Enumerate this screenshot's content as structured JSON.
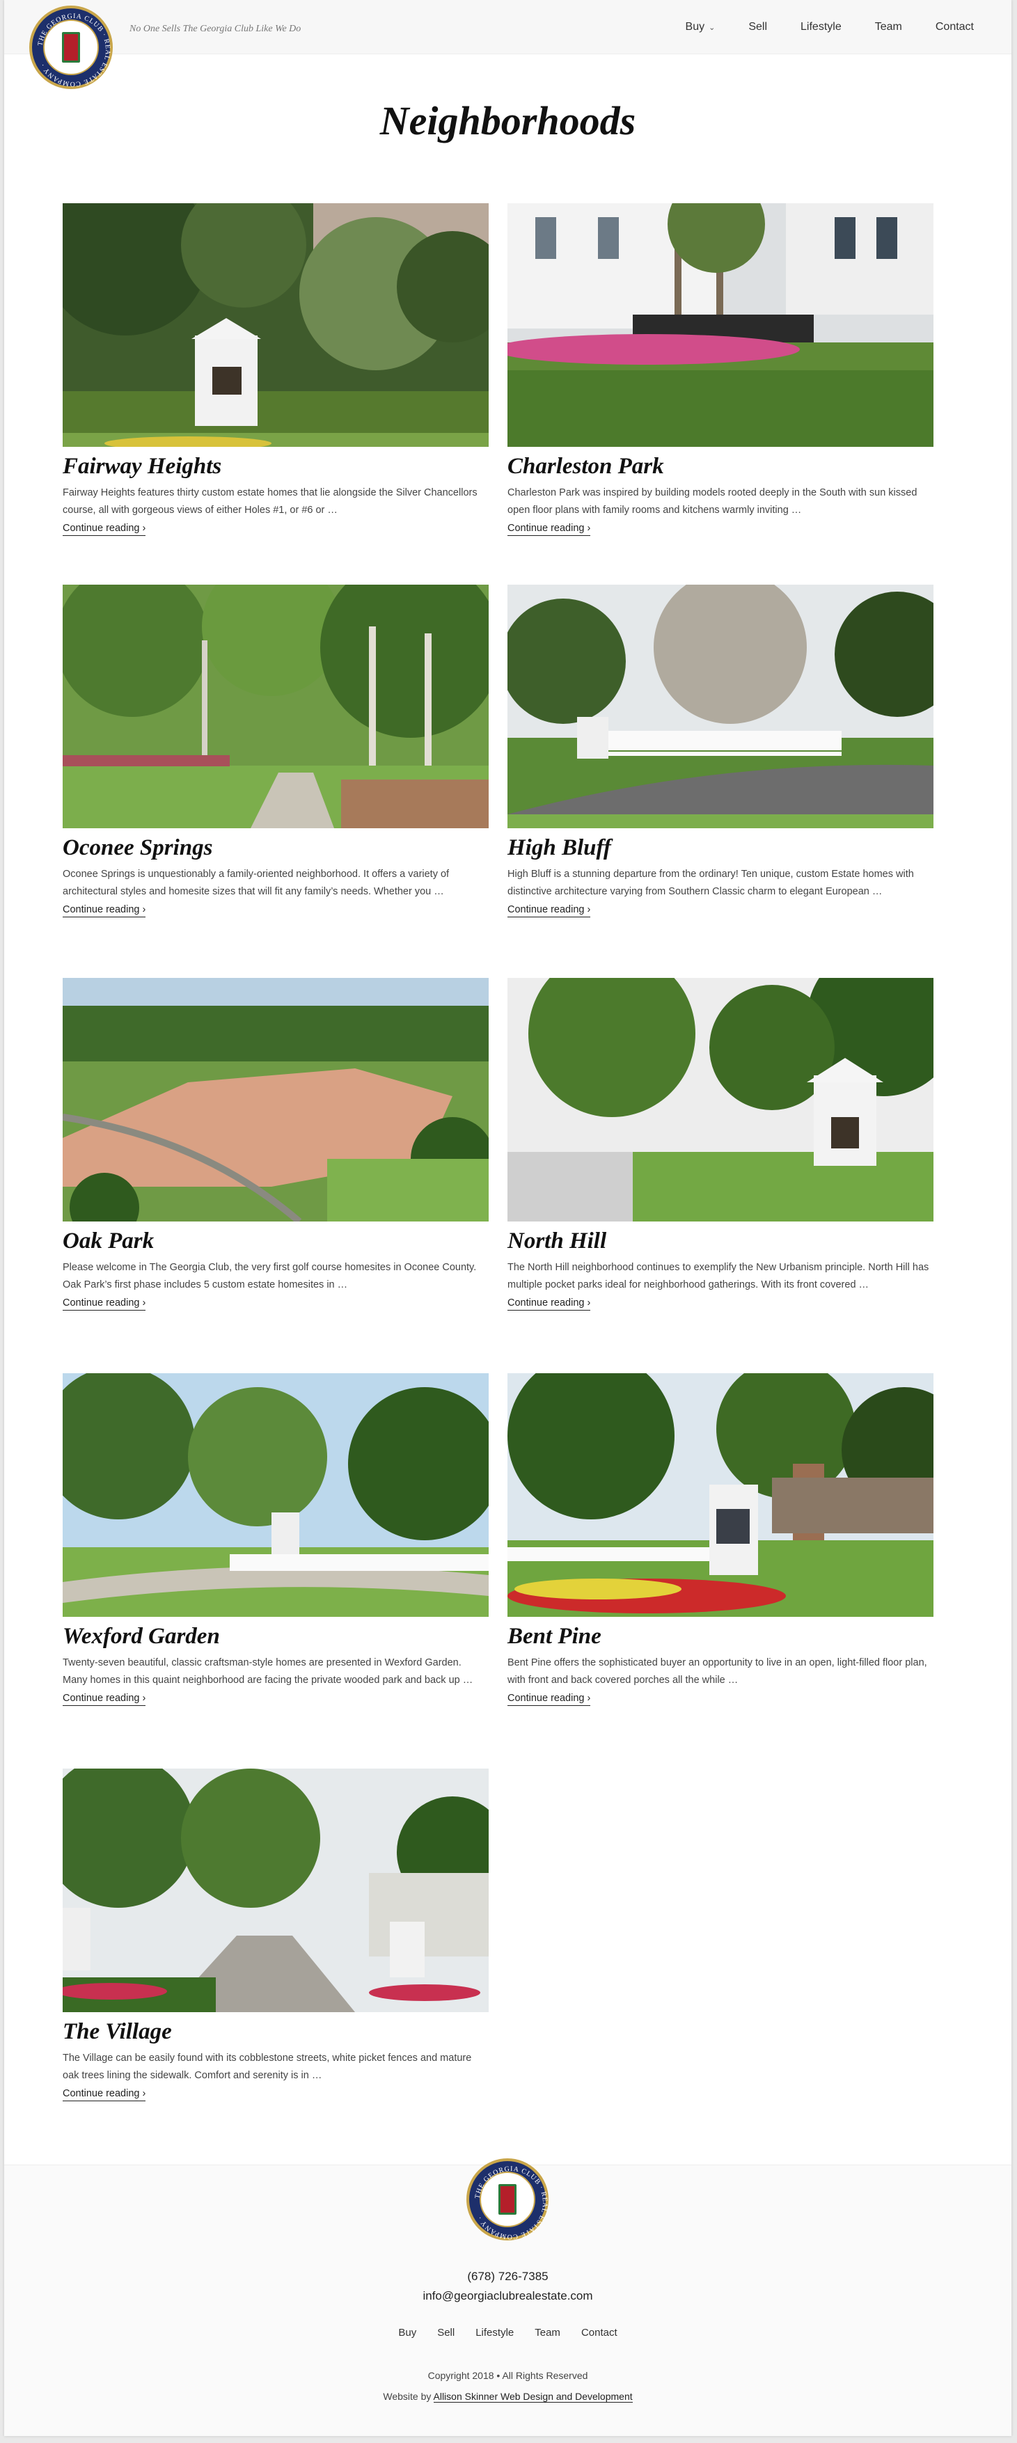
{
  "header": {
    "tagline": "No One Sells The Georgia Club Like We Do",
    "logo_text": "THE GEORGIA CLUB REAL ESTATE COMPANY",
    "nav": [
      {
        "label": "Buy",
        "has_dropdown": true
      },
      {
        "label": "Sell"
      },
      {
        "label": "Lifestyle"
      },
      {
        "label": "Team"
      },
      {
        "label": "Contact"
      }
    ]
  },
  "page_title": "Neighborhoods",
  "neighborhoods": [
    {
      "title": "Fairway Heights",
      "excerpt": "Fairway Heights features thirty custom estate homes that lie alongside the Silver Chancellors course, all with gorgeous views of either  Holes #1, or #6 or  …",
      "link": "Continue reading"
    },
    {
      "title": "Charleston Park",
      "excerpt": "Charleston Park was inspired by building models rooted deeply in the South with sun kissed open floor plans with family rooms and kitchens warmly inviting …",
      "link": "Continue reading"
    },
    {
      "title": "Oconee Springs",
      "excerpt": "Oconee Springs is unquestionably a family-oriented neighborhood.  It offers a variety of architectural styles and homesite sizes that will fit any family’s needs.  Whether you …",
      "link": "Continue reading"
    },
    {
      "title": "High Bluff",
      "excerpt": "High Bluff is a stunning departure from the ordinary!  Ten unique, custom Estate homes with distinctive architecture varying from Southern Classic charm to elegant European …",
      "link": "Continue reading"
    },
    {
      "title": "Oak Park",
      "excerpt": "Please welcome in The Georgia Club, the very first golf course homesites in Oconee County.  Oak Park’s first phase includes 5 custom estate homesites in …",
      "link": "Continue reading"
    },
    {
      "title": "North Hill",
      "excerpt": "The North Hill neighborhood continues to exemplify the  New Urbanism principle.  North Hill has multiple pocket parks ideal for neighborhood gatherings.  With its front covered …",
      "link": "Continue reading"
    },
    {
      "title": "Wexford Garden",
      "excerpt": "Twenty-seven beautiful, classic craftsman-style homes are presented in Wexford Garden.  Many homes in this quaint neighborhood are facing the private wooded park and back up …",
      "link": "Continue reading"
    },
    {
      "title": "Bent Pine",
      "excerpt": "Bent Pine offers the sophisticated buyer an opportunity to live in an open, light-filled floor plan, with front and back covered porches all the while …",
      "link": "Continue reading"
    },
    {
      "title": "The Village",
      "excerpt": "The Village can be easily found with its cobblestone streets, white picket fences and mature oak trees lining the sidewalk. Comfort and serenity is in …",
      "link": "Continue reading"
    }
  ],
  "footer": {
    "phone": "(678) 726-7385",
    "email": "info@georgiaclubrealestate.com",
    "nav": [
      "Buy",
      "Sell",
      "Lifestyle",
      "Team",
      "Contact"
    ],
    "copyright": "Copyright 2018 • All Rights Reserved",
    "credit_prefix": "Website by ",
    "credit_link": "Allison Skinner Web Design and Development"
  },
  "colors": {
    "navy": "#1d2f6b",
    "gold": "#c9a64a",
    "door_red": "#b41f2a"
  }
}
